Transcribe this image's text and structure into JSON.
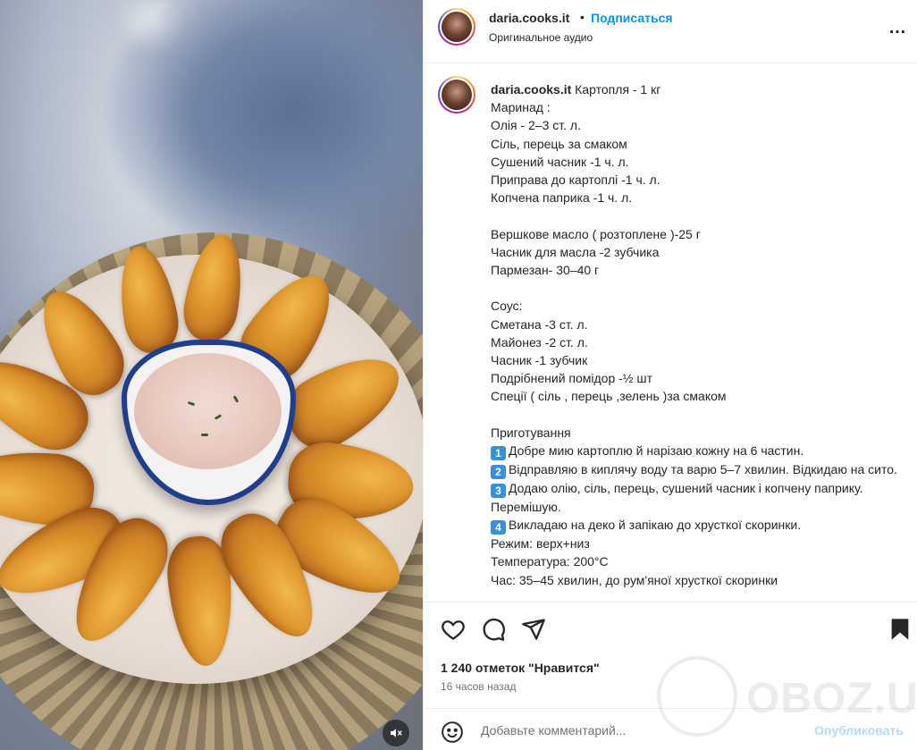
{
  "header": {
    "username": "daria.cooks.it",
    "separator": "•",
    "follow_label": "Подписаться",
    "audio_label": "Оригинальное аудио",
    "more_icon": "…"
  },
  "caption": {
    "username": "daria.cooks.it",
    "first_line": " Картопля - 1 кг",
    "lines": [
      "Маринад :",
      "Олія - 2–3 ст. л.",
      "Сіль, перець за смаком",
      "Сушений часник -1 ч. л.",
      "Приправа до картоплі -1 ч. л.",
      "Копчена паприка -1 ч. л.",
      "",
      "Вершкове масло ( розтоплене )-25 г",
      "Часник для масла -2 зубчика",
      "Пармезан- 30–40 г",
      "",
      "Соус:",
      "Сметана -3 ст. л.",
      "Майонез -2 ст. л.",
      "Часник -1 зубчик",
      "Подрібнений помідор -½ шт",
      "Спеції ( сіль , перець ,зелень )за смаком",
      "",
      "Приготування"
    ],
    "steps": [
      {
        "num": "1",
        "text": "Добре мию картоплю й нарізаю кожну на 6 частин."
      },
      {
        "num": "2",
        "text": "Відправляю в киплячу воду та варю 5–7 хвилин. Відкидаю на сито."
      },
      {
        "num": "3",
        "text": "Додаю олію, сіль, перець, сушений часник і копчену паприку. Перемішую."
      },
      {
        "num": "4",
        "text": "Викладаю на деко й запікаю до хрусткої скоринки."
      }
    ],
    "tail_lines": [
      "Режим: верх+низ",
      "Температура: 200°C",
      "Час: 35–45 хвилин, до рум'яної хрусткої скоринки"
    ]
  },
  "actions": {
    "likes": "1 240 отметок \"Нравится\"",
    "time": "16 часов назад"
  },
  "comment": {
    "placeholder": "Добавьте комментарий...",
    "publish_label": "Опубликовать"
  },
  "watermark": {
    "text": "OBOZ.UA"
  },
  "icons": {
    "like": "heart-icon",
    "comment": "comment-icon",
    "share": "send-icon",
    "save": "bookmark-icon",
    "emoji": "emoji-icon",
    "mute": "speaker-muted-icon",
    "more": "more-icon"
  },
  "colors": {
    "link": "#0095f6",
    "publish_disabled": "#b3dbff",
    "text": "#262626",
    "muted": "#737373"
  }
}
